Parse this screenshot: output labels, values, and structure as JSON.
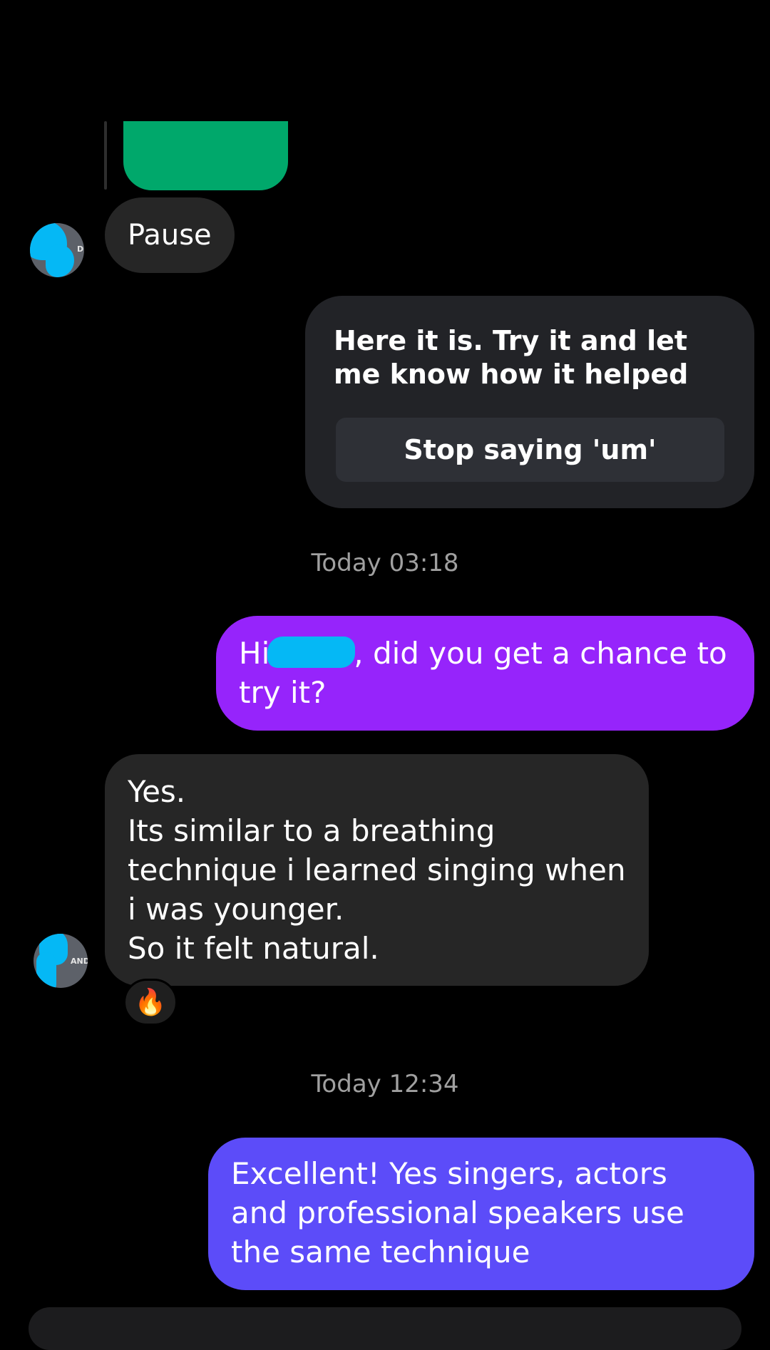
{
  "thread": {
    "pause_message": "Pause",
    "share_card": {
      "text": "Here it is. Try it and let me know how it helped",
      "button_label": "Stop saying 'um'"
    },
    "timestamp_1": "Today 03:18",
    "outgoing_1": {
      "prefix": "Hi",
      "suffix": ", did you get a chance to try it?"
    },
    "incoming_2": {
      "lines": [
        "Yes.",
        "Its similar to a breathing",
        "technique i learned singing when",
        "i was younger.",
        "So it felt natural."
      ]
    },
    "reaction_emoji": "🔥",
    "timestamp_2": "Today 12:34",
    "outgoing_2": "Excellent! Yes singers, actors and professional speakers use the same technique"
  },
  "colors": {
    "background": "#000000",
    "incoming_bubble": "#262626",
    "share_card": "#222327",
    "outgoing_purple": "#9624fb",
    "outgoing_indigo": "#5c4cf9",
    "redaction": "#05b8f5",
    "green_preview": "#00a86b"
  }
}
